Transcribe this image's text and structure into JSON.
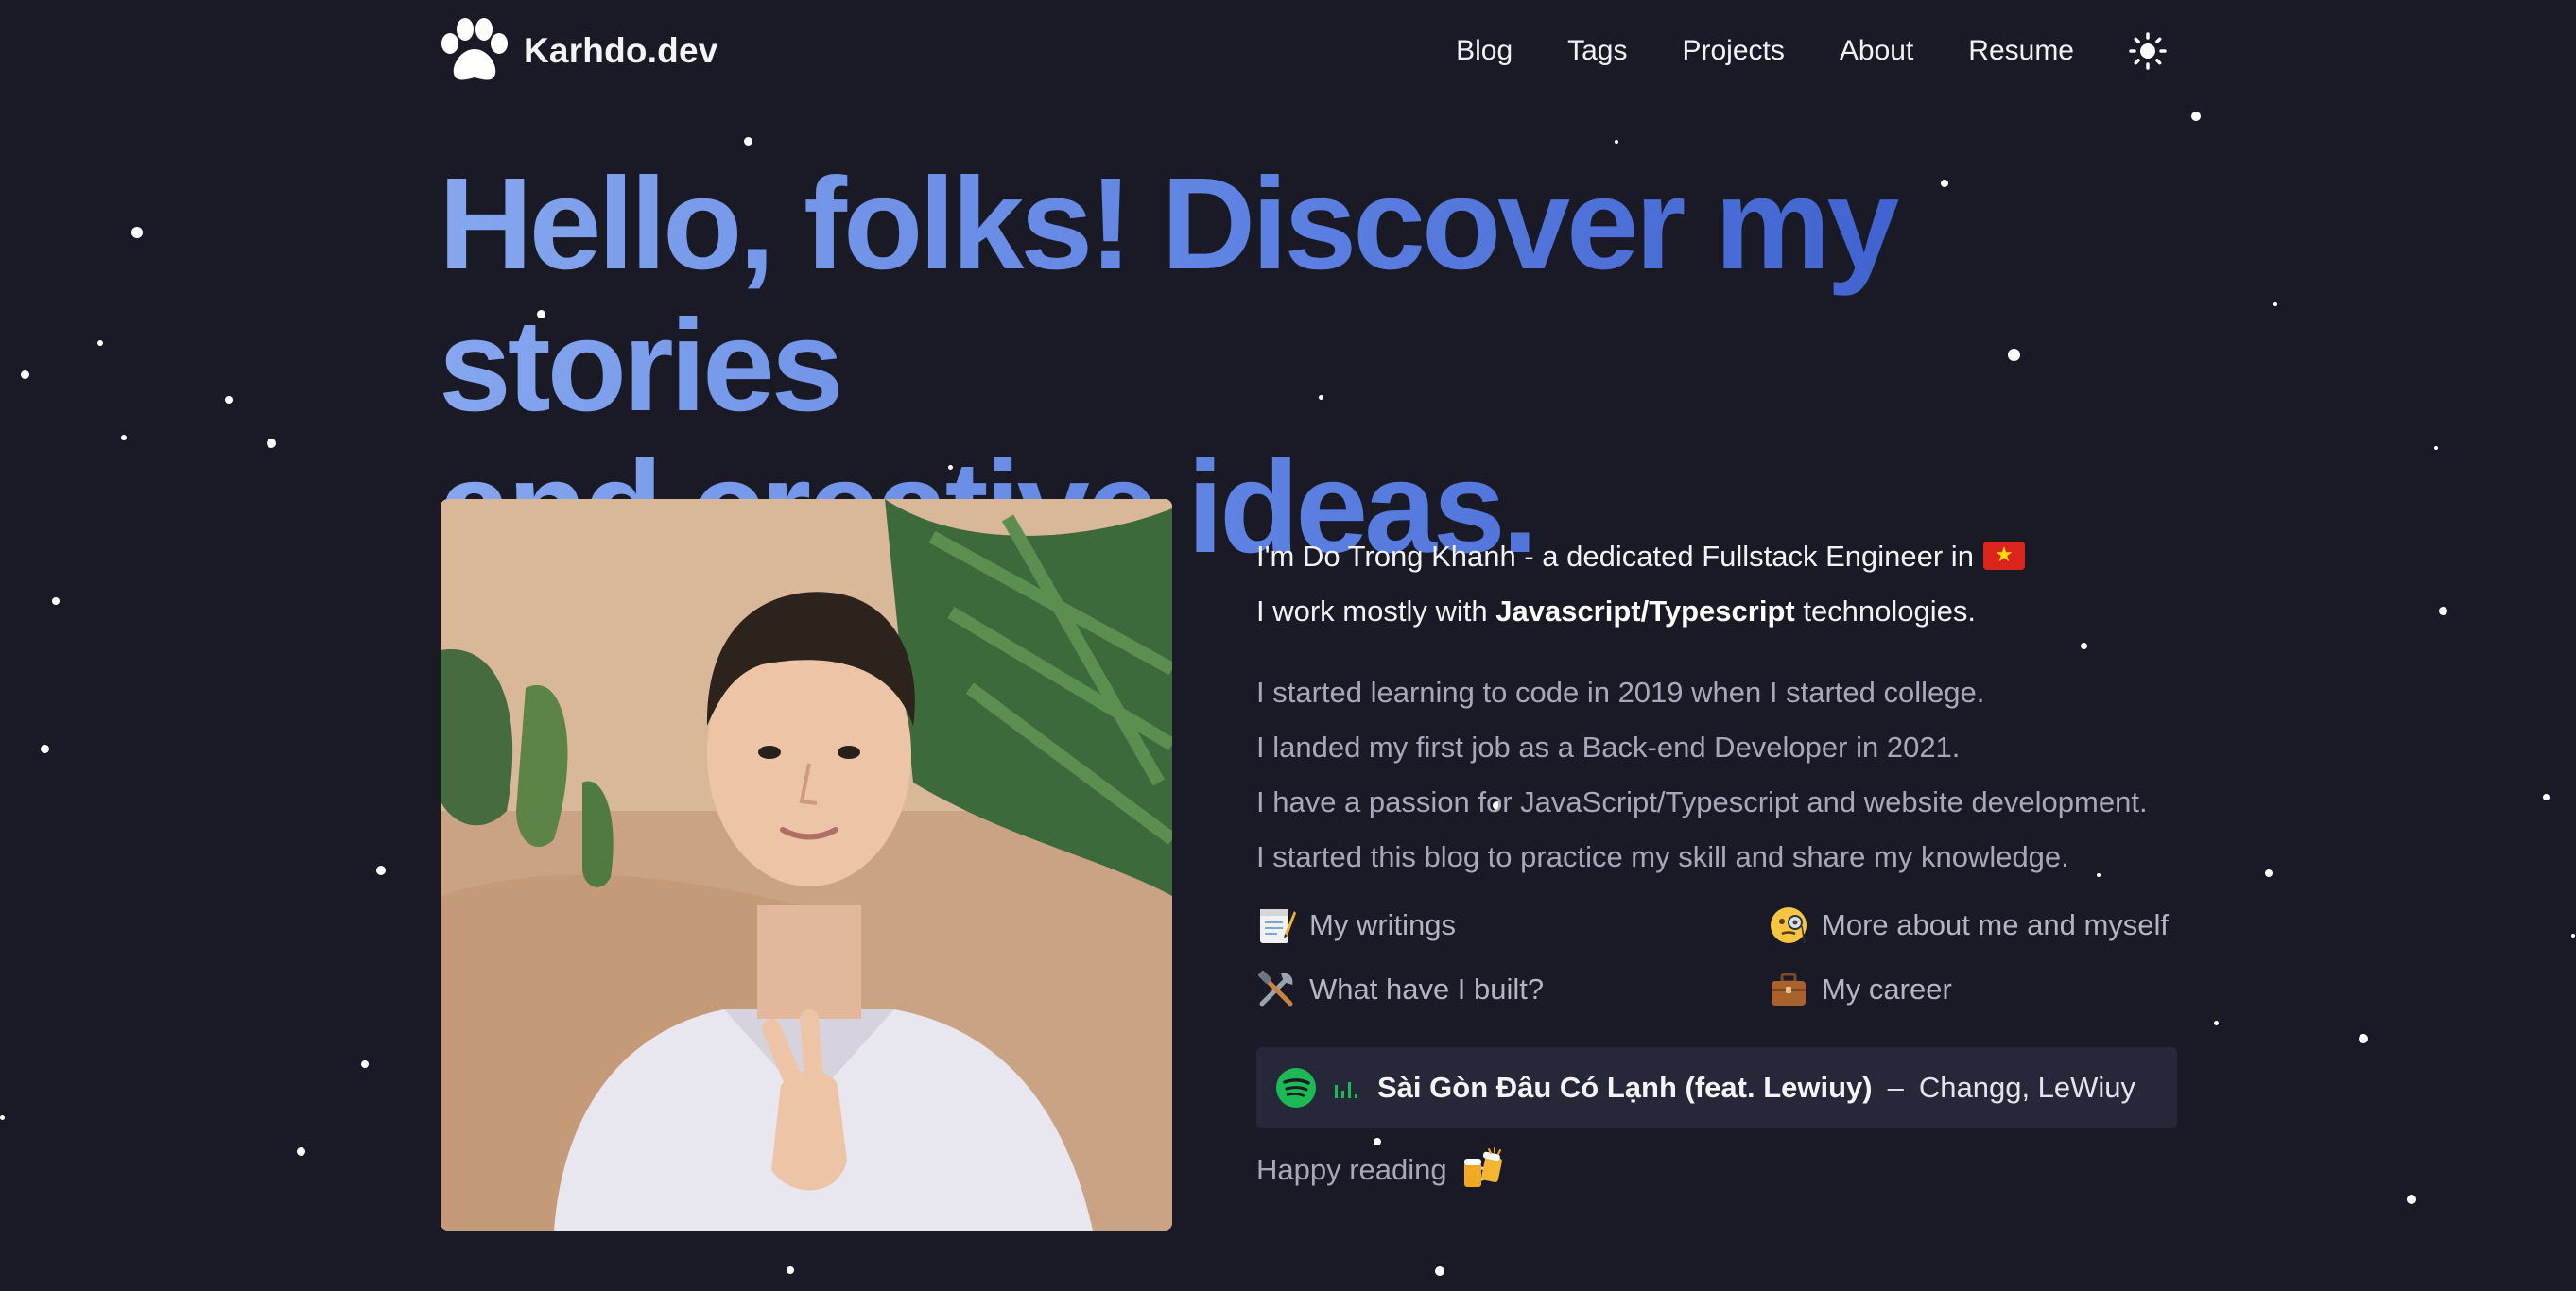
{
  "header": {
    "logo_text": "Karhdo.dev",
    "nav": [
      "Blog",
      "Tags",
      "Projects",
      "About",
      "Resume"
    ]
  },
  "hero": {
    "title_line1": "Hello, folks! Discover my stories",
    "title_line2": "and creative ideas."
  },
  "intro": {
    "line1_prefix": "I'm Do Trong Khanh - a dedicated Fullstack Engineer in",
    "flag_icon": "vietnam-flag",
    "line2_prefix": "I work mostly with",
    "line2_strong": "Javascript/Typescript",
    "line2_suffix": "technologies.",
    "paragraphs": [
      "I started learning to code in 2019 when I started college.",
      "I landed my first job as a Back-end Developer in 2021.",
      "I have a passion for JavaScript/Typescript and website development.",
      "I started this blog to practice my skill and share my knowledge."
    ]
  },
  "links": [
    {
      "label": "My writings",
      "icon": "memo-icon"
    },
    {
      "label": "More about me and myself",
      "icon": "monocle-face-icon"
    },
    {
      "label": "What have I built?",
      "icon": "tools-icon"
    },
    {
      "label": "My career",
      "icon": "briefcase-icon"
    }
  ],
  "now_playing": {
    "song": "Sài Gòn Đâu Có Lạnh (feat. Lewiuy)",
    "separator": "–",
    "artist": "Changg, LeWiuy"
  },
  "footer": {
    "text": "Happy reading",
    "icon": "beer-mugs-icon"
  },
  "colors": {
    "background": "#1a1a27",
    "title_gradient_start": "#86a7ee",
    "title_gradient_end": "#3455c8",
    "spotify_green": "#1db954"
  }
}
